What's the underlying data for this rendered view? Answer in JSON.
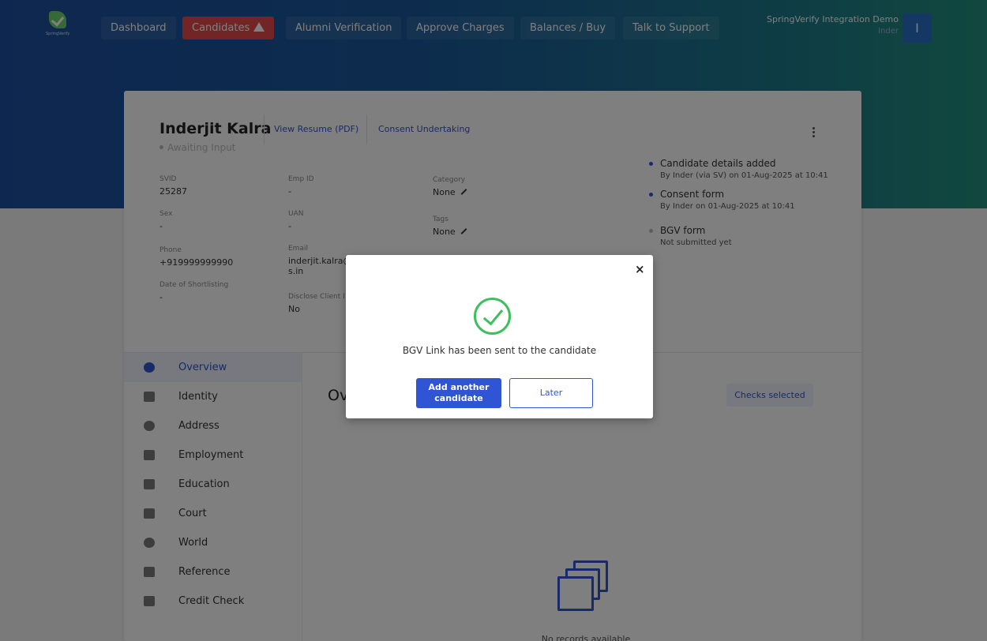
{
  "brand": {
    "logo_text": "SpringVerify"
  },
  "nav": {
    "items": [
      {
        "label": "Dashboard"
      },
      {
        "label": "Candidates"
      },
      {
        "label": "Alumni Verification"
      },
      {
        "label": "Approve Charges"
      },
      {
        "label": "Balances / Buy"
      },
      {
        "label": "Talk to Support"
      }
    ],
    "org_name": "SpringVerify Integration Demo",
    "user_name": "Inder",
    "avatar_initial": "I"
  },
  "candidate": {
    "name": "Inderjit Kalra",
    "status": "Awaiting Input",
    "view_resume": "View Resume (PDF)",
    "consent": "Consent Undertaking",
    "fields": {
      "svid_label": "SVID",
      "svid": "25287",
      "sex_label": "Sex",
      "sex": "-",
      "phone_label": "Phone",
      "phone": "+919999999990",
      "dos_label": "Date of Shortlisting",
      "dos": "-",
      "empid_label": "Emp ID",
      "empid": "-",
      "uan_label": "UAN",
      "uan": "-",
      "email_label": "Email",
      "email": "inderjit.kalra@",
      "email_cont": "s.in",
      "disclose_label": "Disclose Client I",
      "disclose": "No",
      "category_label": "Category",
      "category": "None",
      "tags_label": "Tags",
      "tags": "None"
    }
  },
  "timeline": [
    {
      "title": "Candidate details added",
      "sub": "By Inder (via SV) on 01-Aug-2025 at 10:41"
    },
    {
      "title": "Consent form",
      "sub": "By Inder on 01-Aug-2025 at 10:41"
    },
    {
      "title": "BGV form",
      "sub": "Not submitted yet"
    }
  ],
  "sidebar": {
    "items": [
      {
        "label": "Overview"
      },
      {
        "label": "Identity"
      },
      {
        "label": "Address"
      },
      {
        "label": "Employment"
      },
      {
        "label": "Education"
      },
      {
        "label": "Court"
      },
      {
        "label": "World"
      },
      {
        "label": "Reference"
      },
      {
        "label": "Credit Check"
      }
    ]
  },
  "main": {
    "title": "Ov",
    "checks_selected": "Checks selected",
    "empty_text": "No records available"
  },
  "modal": {
    "close": "×",
    "message": "BGV Link has been sent to the candidate",
    "primary_label_1": "Add another",
    "primary_label_2": "candidate",
    "secondary_label": "Later"
  },
  "colors": {
    "accent": "#2f55d4",
    "danger": "#e74b4b",
    "success": "#3cbf5c"
  }
}
